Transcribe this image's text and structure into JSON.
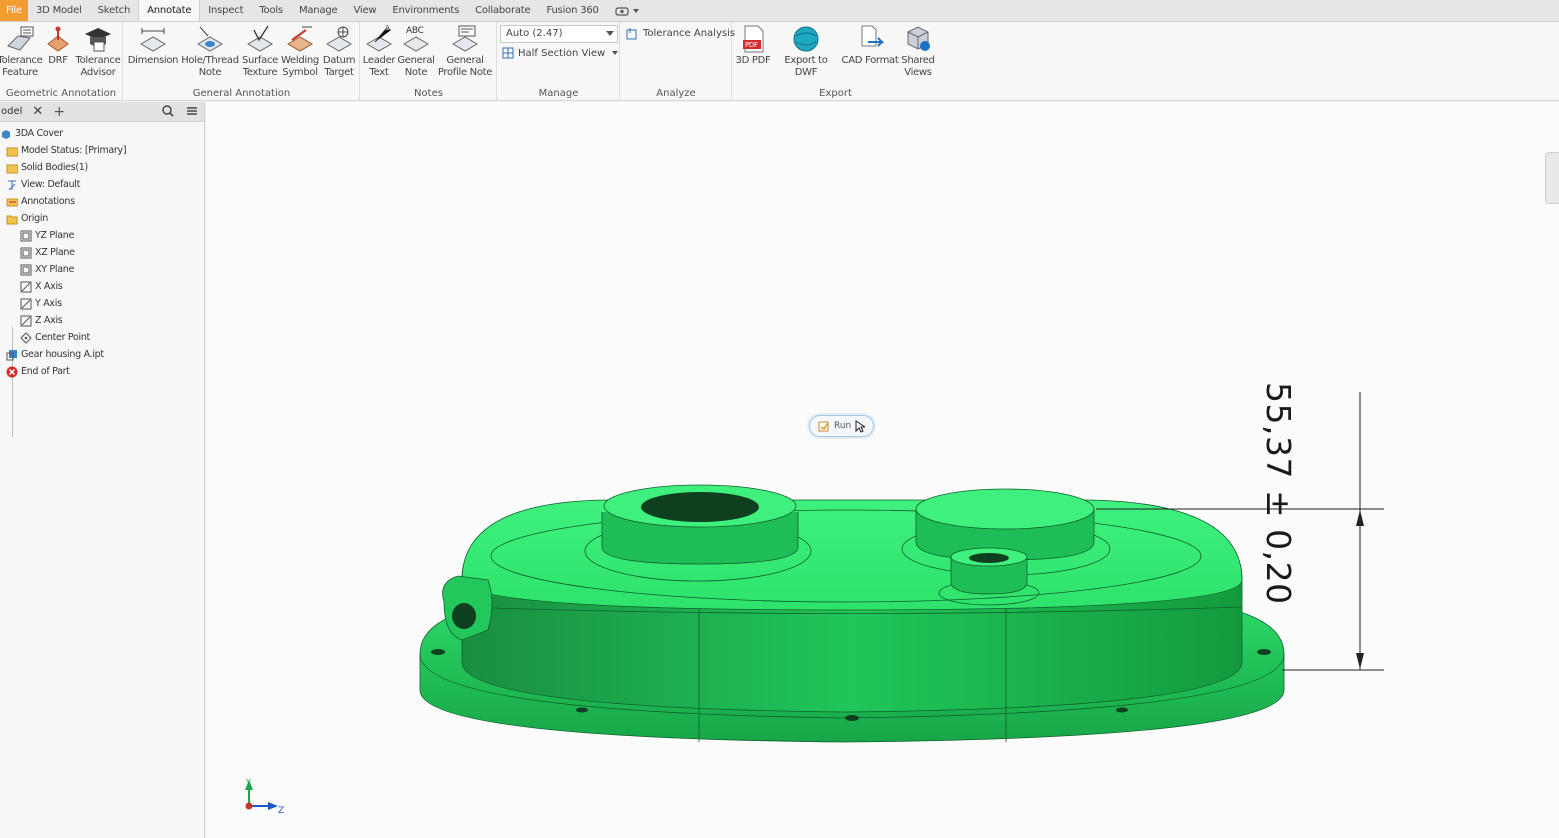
{
  "menu": {
    "tabs": [
      "File",
      "3D Model",
      "Sketch",
      "Annotate",
      "Inspect",
      "Tools",
      "Manage",
      "View",
      "Environments",
      "Collaborate",
      "Fusion 360"
    ],
    "active": "Annotate"
  },
  "ribbon": {
    "panels": {
      "geometric": "Geometric Annotation",
      "general": "General Annotation",
      "notes": "Notes",
      "manage": "Manage",
      "analyze": "Analyze",
      "export": "Export"
    },
    "buttons": {
      "tolerance_feature": "Tolerance\nFeature",
      "drf": "DRF",
      "tolerance_advisor": "Tolerance\nAdvisor",
      "dimension": "Dimension",
      "hole_thread_note": "Hole/Thread\nNote",
      "surface_texture": "Surface\nTexture",
      "welding_symbol": "Welding\nSymbol",
      "datum_target": "Datum\nTarget",
      "leader_text": "Leader\nText",
      "general_note": "General\nNote",
      "general_profile_note": "General\nProfile Note",
      "pdf_3d": "3D PDF",
      "export_dwf": "Export to DWF",
      "cad_format": "CAD Format",
      "shared_views": "Shared\nViews"
    },
    "manage": {
      "scale_value": "Auto (2.47)",
      "half_section": "Half Section View"
    },
    "analyze": {
      "tolerance_analysis": "Tolerance Analysis"
    },
    "ribbon_labels": {
      "abc": "ABC",
      "pdf": "PDF"
    }
  },
  "browser": {
    "tab_label": "odel",
    "items": [
      {
        "label": "3DA Cover"
      },
      {
        "label": "Model Status: [Primary]"
      },
      {
        "label": "Solid Bodies(1)"
      },
      {
        "label": "View: Default"
      },
      {
        "label": "Annotations"
      },
      {
        "label": "Origin"
      },
      {
        "label": "YZ Plane"
      },
      {
        "label": "XZ Plane"
      },
      {
        "label": "XY Plane"
      },
      {
        "label": "X Axis"
      },
      {
        "label": "Y Axis"
      },
      {
        "label": "Z Axis"
      },
      {
        "label": "Center Point"
      },
      {
        "label": "Gear housing A.ipt"
      },
      {
        "label": "End of Part"
      }
    ]
  },
  "viewport": {
    "dimension_text": "55,37 ± 0,20",
    "mini_button_label": "Run",
    "triad": {
      "y": "Y",
      "z": "Z"
    },
    "model_color": "#2ee26b"
  },
  "colors": {
    "file_tab": "#f39c34",
    "accent": "#2ee26b"
  }
}
